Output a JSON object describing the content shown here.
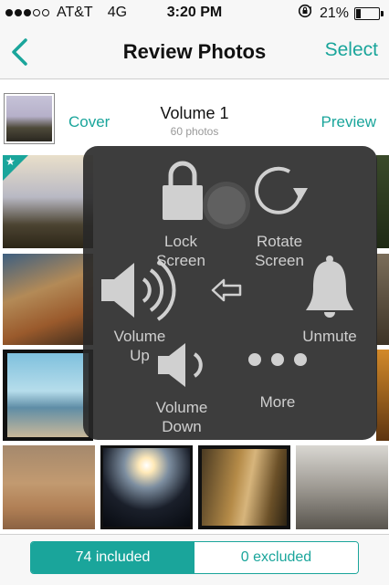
{
  "status_bar": {
    "carrier": "AT&T",
    "network": "4G",
    "time": "3:20 PM",
    "battery_percent": "21%",
    "battery_level": 0.21,
    "signal_bars": 3
  },
  "nav": {
    "back_icon": "chevron-left-icon",
    "title": "Review Photos",
    "select_label": "Select"
  },
  "volume": {
    "cover_label": "Cover",
    "title": "Volume 1",
    "count": "60 photos",
    "preview_label": "Preview"
  },
  "assistive_menu": {
    "lock_screen": "Lock\nScreen",
    "rotate_screen": "Rotate\nScreen",
    "volume_up": "Volume\nUp",
    "unmute": "Unmute",
    "volume_down": "Volume\nDown",
    "more": "More"
  },
  "filter": {
    "included": "74 included",
    "excluded": "0 excluded"
  },
  "colors": {
    "accent": "#1aa59b"
  }
}
